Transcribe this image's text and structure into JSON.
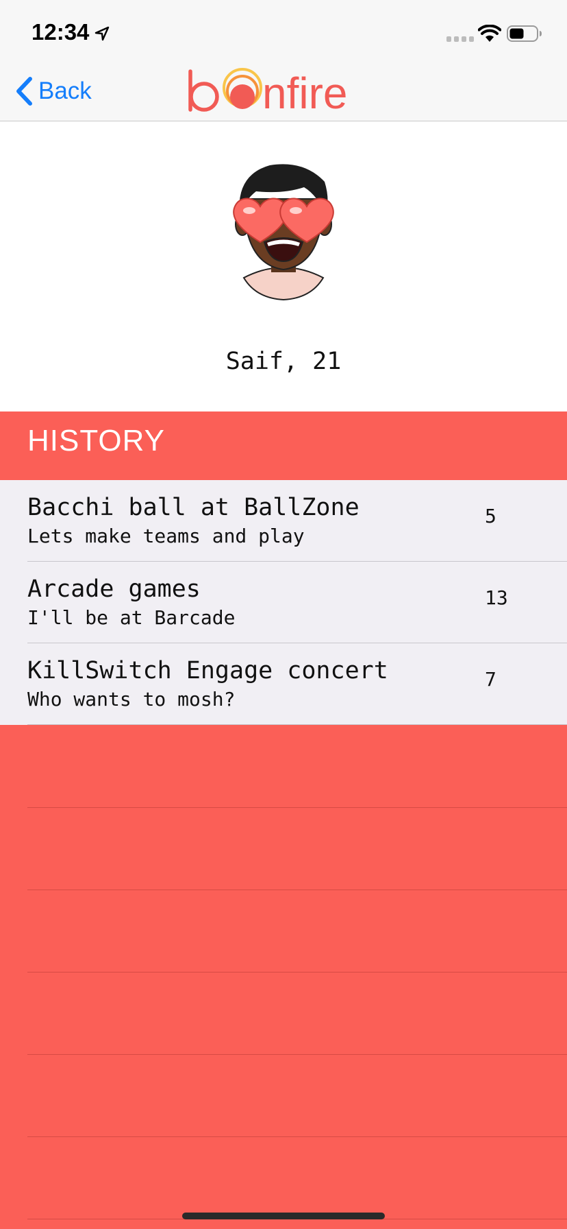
{
  "status_bar": {
    "time": "12:34",
    "icons": [
      "location-arrow-icon",
      "cellular-signal-icon",
      "wifi-icon",
      "battery-icon"
    ]
  },
  "nav": {
    "back_label": "Back",
    "back_icon": "chevron-left-icon",
    "logo_text": "bonfire"
  },
  "profile": {
    "avatar_icon": "heart-eyes-avatar",
    "name_age": "Saif, 21"
  },
  "history": {
    "title": "HISTORY",
    "items": [
      {
        "title": "Bacchi ball at BallZone",
        "subtitle": "Lets make teams and play",
        "count": "5"
      },
      {
        "title": "Arcade games",
        "subtitle": "I'll be at Barcade",
        "count": "13"
      },
      {
        "title": "KillSwitch Engage concert",
        "subtitle": "Who wants to mosh?",
        "count": "7"
      }
    ]
  },
  "colors": {
    "accent": "#fb5f57",
    "link": "#157efb",
    "list_background": "#f1eff4",
    "nav_background": "#f7f7f7"
  }
}
